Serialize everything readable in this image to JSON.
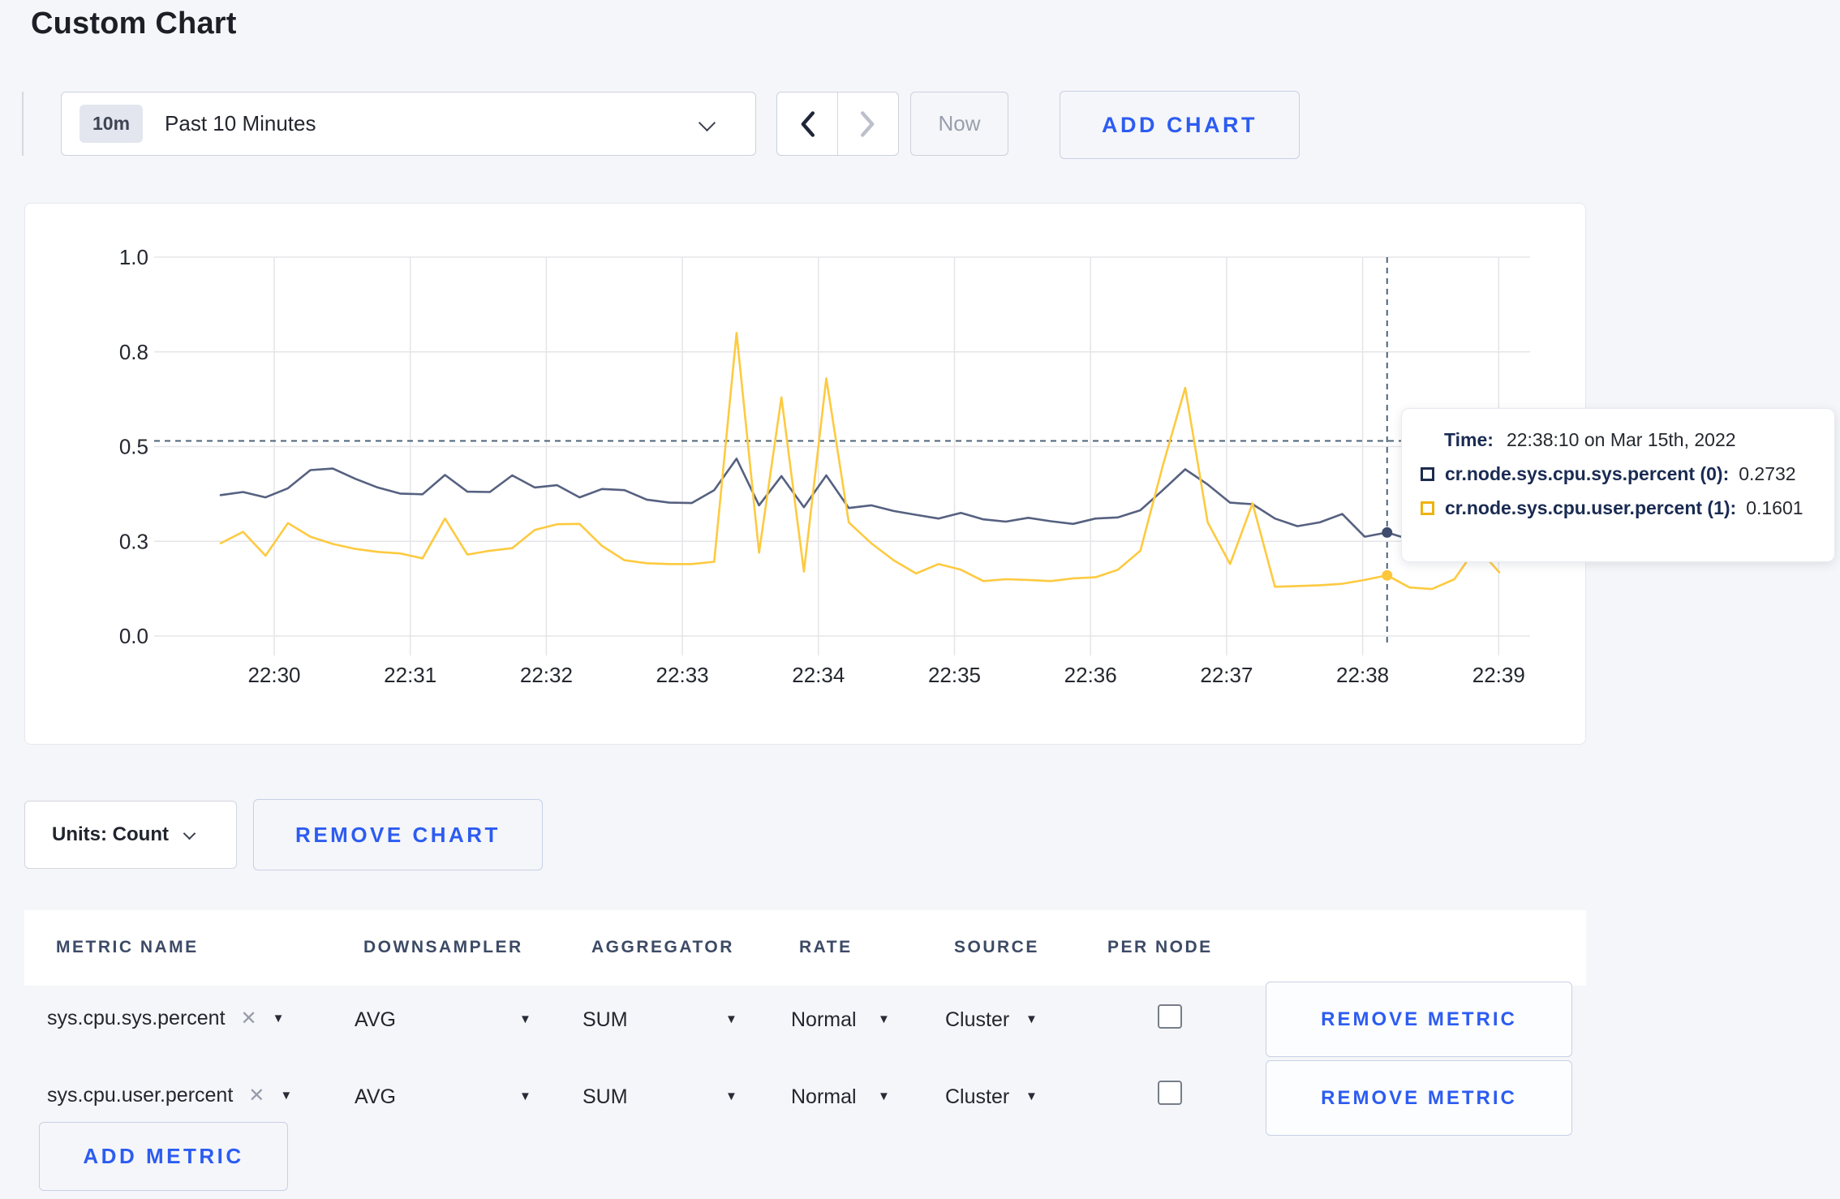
{
  "page": {
    "title": "Custom Chart"
  },
  "toolbar": {
    "time_window_badge": "10m",
    "time_window_label": "Past 10 Minutes",
    "now_label": "Now",
    "add_chart_label": "ADD CHART"
  },
  "chart_data": {
    "type": "line",
    "title": "",
    "xlabel": "",
    "ylabel": "",
    "ylim": [
      0,
      1
    ],
    "grid": true,
    "x_ticks": [
      "22:30",
      "22:31",
      "22:32",
      "22:33",
      "22:34",
      "22:35",
      "22:36",
      "22:37",
      "22:38",
      "22:39"
    ],
    "y_ticks": [
      {
        "label": "1.0",
        "value": 1.0
      },
      {
        "label": "0.8",
        "value": 0.75
      },
      {
        "label": "0.5",
        "value": 0.5
      },
      {
        "label": "0.3",
        "value": 0.25
      },
      {
        "label": "0.0",
        "value": 0.0
      }
    ],
    "sample_interval_seconds": 10,
    "series": [
      {
        "name": "cr.node.sys.cpu.sys.percent",
        "color": "#566180",
        "values": [
          0.372,
          0.38,
          0.366,
          0.39,
          0.438,
          0.442,
          0.415,
          0.392,
          0.376,
          0.374,
          0.425,
          0.381,
          0.38,
          0.424,
          0.392,
          0.398,
          0.366,
          0.388,
          0.385,
          0.36,
          0.352,
          0.351,
          0.385,
          0.468,
          0.345,
          0.422,
          0.34,
          0.424,
          0.338,
          0.345,
          0.33,
          0.32,
          0.31,
          0.325,
          0.308,
          0.302,
          0.312,
          0.303,
          0.296,
          0.31,
          0.313,
          0.332,
          0.385,
          0.44,
          0.4,
          0.352,
          0.348,
          0.31,
          0.29,
          0.3,
          0.322,
          0.262,
          0.2732,
          0.255,
          0.262,
          0.272,
          0.285,
          0.295
        ]
      },
      {
        "name": "cr.node.sys.cpu.user.percent",
        "color": "#fdca40",
        "values": [
          0.245,
          0.275,
          0.212,
          0.298,
          0.262,
          0.243,
          0.23,
          0.222,
          0.218,
          0.205,
          0.31,
          0.215,
          0.225,
          0.232,
          0.28,
          0.295,
          0.296,
          0.238,
          0.2,
          0.192,
          0.19,
          0.19,
          0.196,
          0.8,
          0.22,
          0.63,
          0.17,
          0.68,
          0.3,
          0.245,
          0.2,
          0.165,
          0.19,
          0.175,
          0.145,
          0.15,
          0.148,
          0.145,
          0.152,
          0.155,
          0.175,
          0.225,
          0.45,
          0.655,
          0.3,
          0.19,
          0.35,
          0.13,
          0.132,
          0.134,
          0.138,
          0.148,
          0.1601,
          0.128,
          0.124,
          0.15,
          0.235,
          0.168
        ]
      }
    ],
    "hover": {
      "index": 52,
      "time": "22:38:10",
      "crosshair_y_value": 0.515,
      "point_values": [
        0.2732,
        0.1601
      ],
      "dot_colors": [
        "#3e4d6d",
        "#fdc73c"
      ]
    },
    "legend_position": "tooltip"
  },
  "tooltip": {
    "time_label": "Time:",
    "time_value": "22:38:10 on Mar 15th, 2022",
    "rows": [
      {
        "label": "cr.node.sys.cpu.sys.percent (0):",
        "value": "0.2732",
        "swatch_color": "#1d2c4e"
      },
      {
        "label": "cr.node.sys.cpu.user.percent (1):",
        "value": "0.1601",
        "swatch_color": "#eeb211"
      }
    ]
  },
  "chart_controls": {
    "units_label": "Units: Count",
    "remove_chart_label": "REMOVE CHART"
  },
  "metrics_table": {
    "columns": [
      "METRIC NAME",
      "DOWNSAMPLER",
      "AGGREGATOR",
      "RATE",
      "SOURCE",
      "PER NODE"
    ],
    "remove_metric_label": "REMOVE METRIC",
    "add_metric_label": "ADD METRIC",
    "rows": [
      {
        "metric": "sys.cpu.sys.percent",
        "downsampler": "AVG",
        "aggregator": "SUM",
        "rate": "Normal",
        "source": "Cluster",
        "per_node_checked": false
      },
      {
        "metric": "sys.cpu.user.percent",
        "downsampler": "AVG",
        "aggregator": "SUM",
        "rate": "Normal",
        "source": "Cluster",
        "per_node_checked": false
      }
    ]
  }
}
